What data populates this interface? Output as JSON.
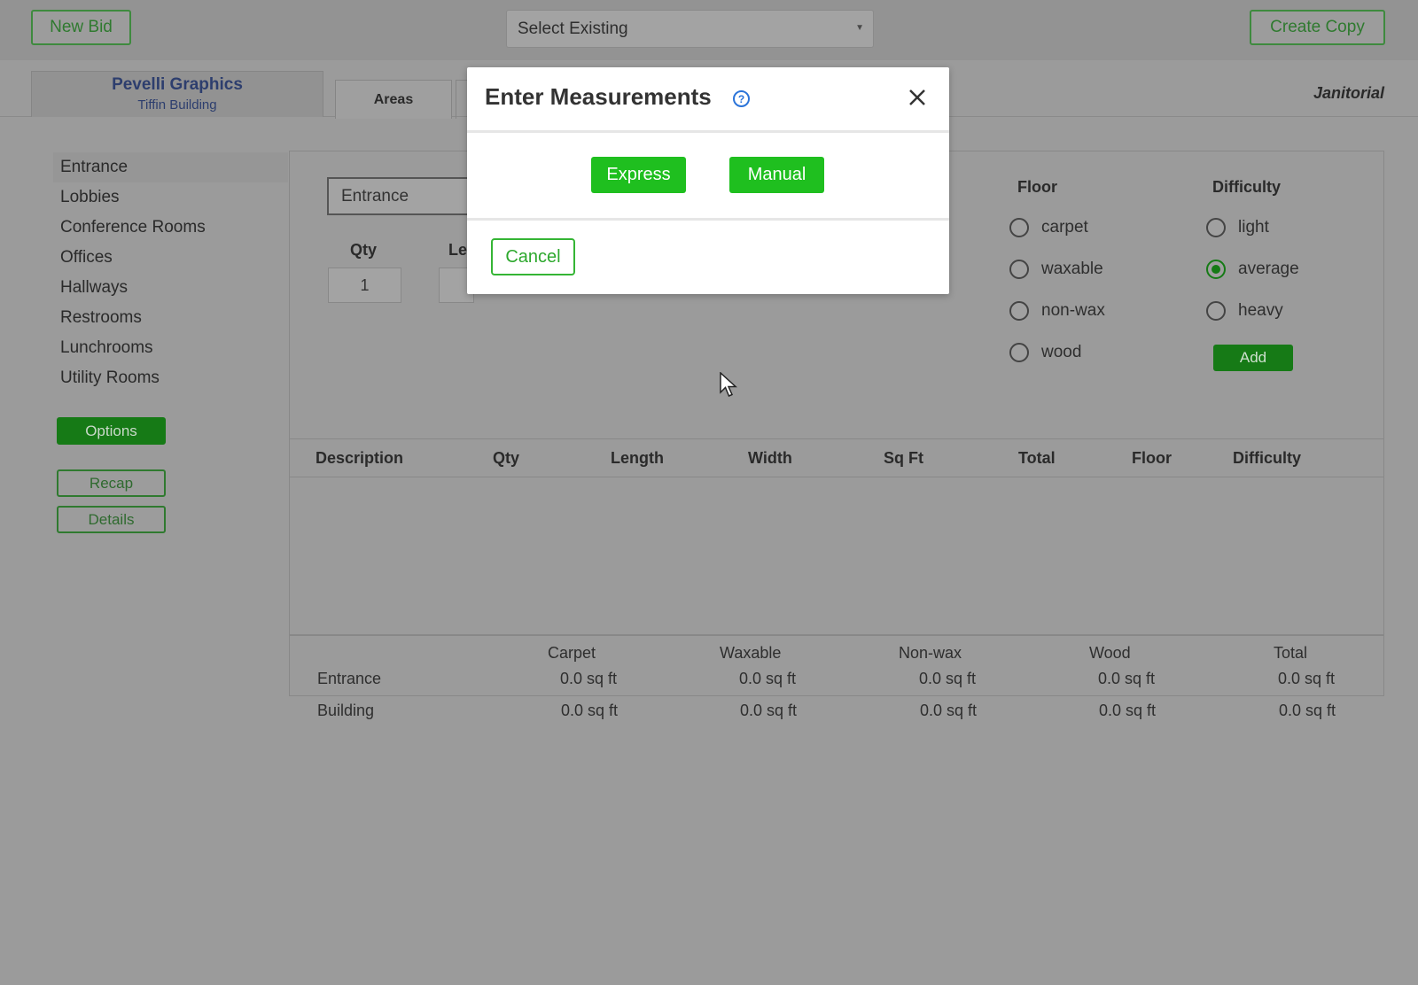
{
  "header": {
    "new_bid": "New Bid",
    "select_existing": "Select Existing",
    "create_copy": "Create Copy"
  },
  "tabs": {
    "company_name": "Pevelli Graphics",
    "company_sub": "Tiffin Building",
    "areas": "Areas",
    "service_type": "Janitorial"
  },
  "sidebar": {
    "items": [
      {
        "label": "Entrance"
      },
      {
        "label": "Lobbies"
      },
      {
        "label": "Conference Rooms"
      },
      {
        "label": "Offices"
      },
      {
        "label": "Hallways"
      },
      {
        "label": "Restrooms"
      },
      {
        "label": "Lunchrooms"
      },
      {
        "label": "Utility Rooms"
      }
    ],
    "options": "Options",
    "recap": "Recap",
    "details": "Details"
  },
  "form": {
    "area_value": "Entrance",
    "qty_label": "Qty",
    "qty_value": "1",
    "length_label_partial": "Le",
    "floor_label": "Floor",
    "floor_options": [
      "carpet",
      "waxable",
      "non-wax",
      "wood"
    ],
    "difficulty_label": "Difficulty",
    "difficulty_options": [
      "light",
      "average",
      "heavy"
    ],
    "difficulty_selected": "average",
    "add": "Add"
  },
  "table": {
    "headers": [
      "Description",
      "Qty",
      "Length",
      "Width",
      "Sq Ft",
      "Total",
      "Floor",
      "Difficulty"
    ]
  },
  "summary": {
    "columns": [
      "Carpet",
      "Waxable",
      "Non-wax",
      "Wood",
      "Total"
    ],
    "rows": [
      {
        "label": "Entrance",
        "values": [
          "0.0 sq ft",
          "0.0 sq ft",
          "0.0 sq ft",
          "0.0 sq ft",
          "0.0 sq ft"
        ]
      },
      {
        "label": "Building",
        "values": [
          "0.0 sq ft",
          "0.0 sq ft",
          "0.0 sq ft",
          "0.0 sq ft",
          "0.0 sq ft"
        ]
      }
    ]
  },
  "modal": {
    "title": "Enter Measurements",
    "help_glyph": "?",
    "express": "Express",
    "manual": "Manual",
    "cancel": "Cancel"
  },
  "colors": {
    "accent_green": "#1fbf1f",
    "dark_green": "#167a16",
    "overlay_gray": "#9b9b9b"
  }
}
